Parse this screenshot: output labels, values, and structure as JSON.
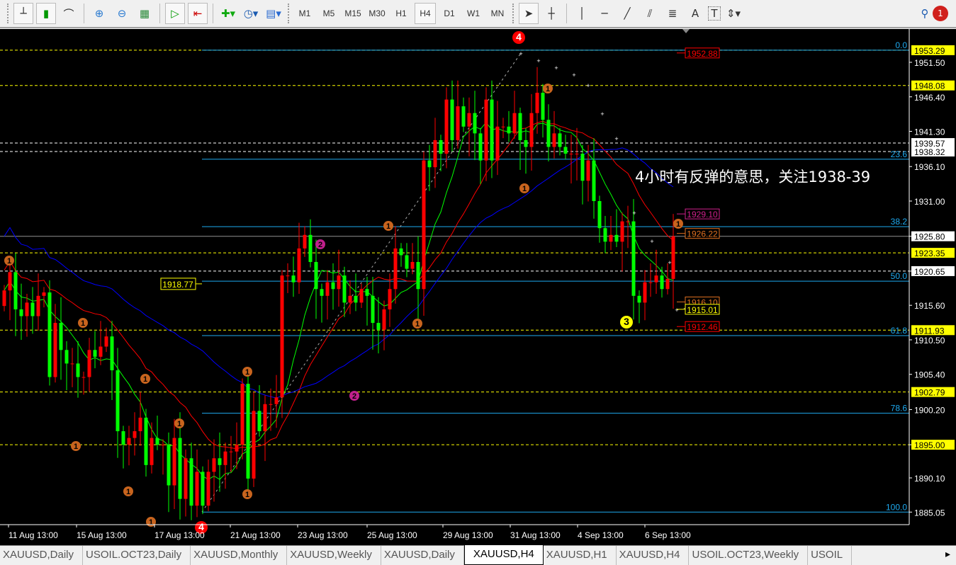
{
  "toolbar": {
    "tools": [
      "bar-chart-icon",
      "candlestick-icon",
      "line-chart-icon",
      "zoom-in-icon",
      "zoom-out-icon",
      "tile-windows-icon",
      "autoscroll-icon",
      "chart-shift-icon",
      "new-order-icon",
      "clock-icon",
      "templates-icon"
    ],
    "timeframes": [
      "M1",
      "M5",
      "M15",
      "M30",
      "H1",
      "H4",
      "D1",
      "W1",
      "MN"
    ],
    "active_timeframe": "H4",
    "draw_tools": [
      "cursor-icon",
      "crosshair-icon",
      "vertical-line-icon",
      "horizontal-line-icon",
      "trendline-icon",
      "equidistant-channel-icon",
      "fibonacci-icon",
      "text-icon",
      "text-label-icon",
      "arrows-icon"
    ],
    "text_tool_label": "A",
    "text_label_tool_label": "T",
    "notification_count": "1"
  },
  "annotation": "4小时有反弹的意思，关注1938-39",
  "chart_data": {
    "type": "candlestick",
    "symbol": "XAUUSD",
    "timeframe": "H4",
    "first_open": 1915.5,
    "closes": [
      1917.8,
      1920.5,
      1915,
      1914,
      1916,
      1914,
      1917,
      1917.5,
      1905,
      1913,
      1909,
      1907,
      1907,
      1905,
      1905,
      1909,
      1908,
      1909.5,
      1911,
      1906,
      1897,
      1895,
      1896,
      1897,
      1899,
      1892,
      1896,
      1895,
      1895,
      1889,
      1896,
      1887,
      1893,
      1886,
      1891,
      1886,
      1891,
      1893,
      1892,
      1894,
      1894,
      1895,
      1904,
      1890,
      1900,
      1897,
      1901,
      1901,
      1902,
      1920,
      1920,
      1919,
      1924,
      1926,
      1922,
      1918,
      1917,
      1919,
      1918,
      1920,
      1916,
      1917,
      1916,
      1918,
      1917,
      1913,
      1912,
      1915,
      1918,
      1924,
      1923,
      1921,
      1922,
      1918,
      1937,
      1936,
      1940,
      1938,
      1946,
      1940,
      1945,
      1942,
      1944,
      1941,
      1937,
      1946,
      1937,
      1942,
      1942,
      1941,
      1944,
      1940,
      1939,
      1944,
      1947,
      1943,
      1939,
      1941,
      1939,
      1938,
      1938,
      1938,
      1934,
      1937,
      1931,
      1927,
      1925,
      1926,
      1925,
      1928,
      1928,
      1917,
      1916,
      1919,
      1919,
      1920,
      1918,
      1919.5,
      1925.8
    ],
    "y_ticks": [
      "1951.50",
      "1946.40",
      "1941.30",
      "1936.10",
      "1931.00",
      "1925.80",
      "1920.65",
      "1915.60",
      "1910.50",
      "1905.40",
      "1900.20",
      "1895.00",
      "1890.10",
      "1885.05"
    ],
    "x_ticks": [
      "11 Aug 13:00",
      "15 Aug 13:00",
      "17 Aug 13:00",
      "21 Aug 13:00",
      "23 Aug 13:00",
      "25 Aug 13:00",
      "29 Aug 13:00",
      "31 Aug 13:00",
      "4 Sep 13:00",
      "6 Sep 13:00"
    ],
    "horizontal_lines": {
      "yellow": [
        {
          "price": 1953.29,
          "label": "1953.29"
        },
        {
          "price": 1948.08,
          "label": "1948.08"
        },
        {
          "price": 1923.35,
          "label": "1923.35"
        },
        {
          "price": 1911.93,
          "label": "1911.93"
        },
        {
          "price": 1902.79,
          "label": "1902.79"
        },
        {
          "price": 1895.0,
          "label": "1895.00"
        }
      ],
      "white": [
        {
          "price": 1939.57,
          "label": "1939.57"
        },
        {
          "price": 1938.32,
          "label": "1938.32"
        },
        {
          "price": 1920.65,
          "label": "1920.65"
        }
      ],
      "bid": {
        "price": 1925.8,
        "label": "1925.80"
      }
    },
    "fibonacci": {
      "high": 1953.29,
      "low": 1885.05,
      "levels": [
        {
          "pct": 0,
          "label": "0.0"
        },
        {
          "pct": 23.6,
          "label": "23.6"
        },
        {
          "pct": 38.2,
          "label": "38.2"
        },
        {
          "pct": 50,
          "label": "50.0"
        },
        {
          "pct": 61.8,
          "label": "61.8"
        },
        {
          "pct": 78.6,
          "label": "78.6"
        },
        {
          "pct": 100,
          "label": "100.0"
        }
      ],
      "mid_label": "1918.77"
    },
    "price_tags": [
      {
        "price": 1952.88,
        "label": "1952.88",
        "color": "#ff0000"
      },
      {
        "price": 1929.1,
        "label": "1929.10",
        "color": "#d0208c"
      },
      {
        "price": 1926.22,
        "label": "1926.22",
        "color": "#e07020"
      },
      {
        "price": 1916.1,
        "label": "1916.10",
        "color": "#e07020"
      },
      {
        "price": 1915.01,
        "label": "1915.01",
        "color": "#ffff00"
      },
      {
        "price": 1912.46,
        "label": "1912.46",
        "color": "#ff0000"
      }
    ],
    "wave_labels": {
      "one": "1",
      "two": "2",
      "three": "3",
      "four": "4"
    },
    "colors": {
      "bull": "#ff0000",
      "bear": "#00ff00",
      "ma_fast": "#00ff00",
      "ma_mid": "#ff0000",
      "ma_slow": "#0000ff",
      "fib": "#1eaaf0"
    }
  },
  "tabs": [
    {
      "label": "XAUUSD,Daily"
    },
    {
      "label": "USOIL.OCT23,Daily"
    },
    {
      "label": "XAUUSD,Monthly"
    },
    {
      "label": "XAUUSD,Weekly"
    },
    {
      "label": "XAUUSD,Daily"
    },
    {
      "label": "XAUUSD,H4",
      "active": true
    },
    {
      "label": "XAUUSD,H1"
    },
    {
      "label": "XAUUSD,H4"
    },
    {
      "label": "USOIL.OCT23,Weekly"
    },
    {
      "label": "USOIL"
    }
  ]
}
